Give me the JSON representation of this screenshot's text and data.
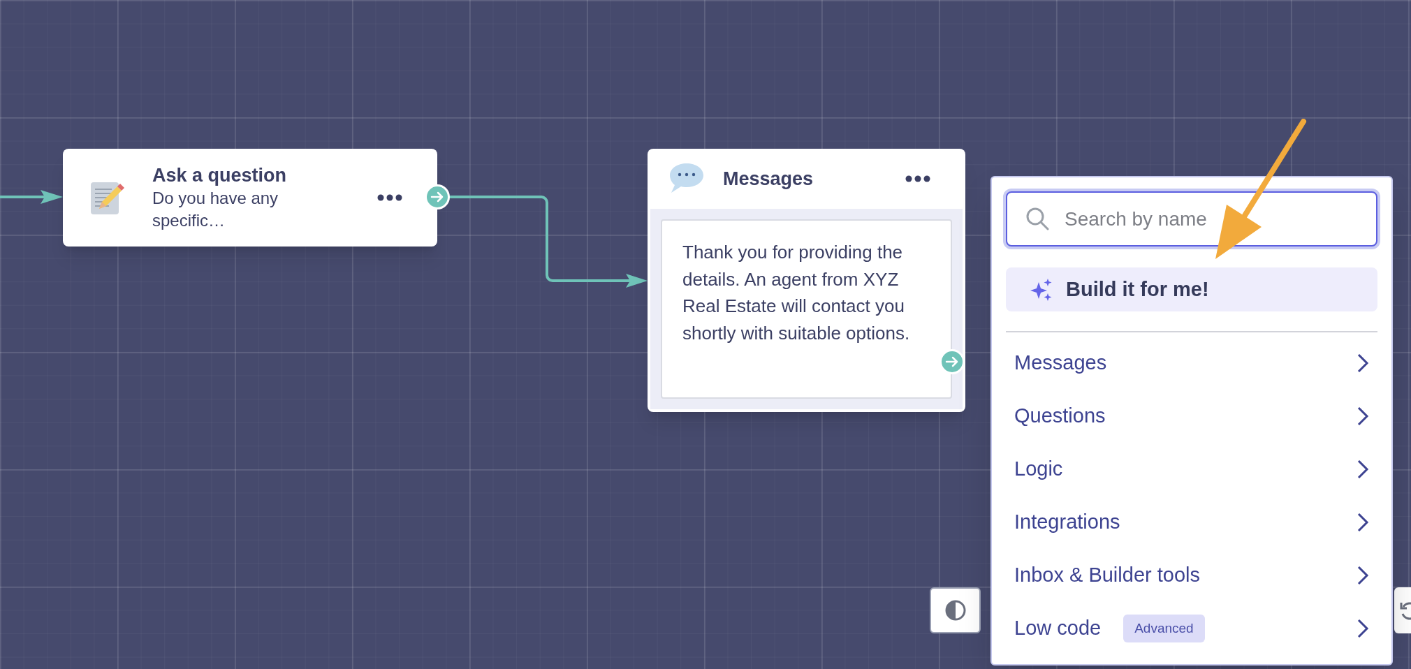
{
  "nodes": [
    {
      "kind": "question",
      "title": "Ask a question",
      "subtitle": "Do you have any specific…"
    },
    {
      "kind": "messages",
      "title": "Messages",
      "message": "Thank you for providing the details. An agent from XYZ Real Estate will contact you shortly with suitable options."
    }
  ],
  "menu": {
    "search": {
      "placeholder": "Search by name"
    },
    "build_button": "Build it for me!",
    "items": [
      {
        "label": "Messages"
      },
      {
        "label": "Questions"
      },
      {
        "label": "Logic"
      },
      {
        "label": "Integrations"
      },
      {
        "label": "Inbox & Builder tools"
      },
      {
        "label": "Low code",
        "badge": "Advanced"
      }
    ]
  }
}
